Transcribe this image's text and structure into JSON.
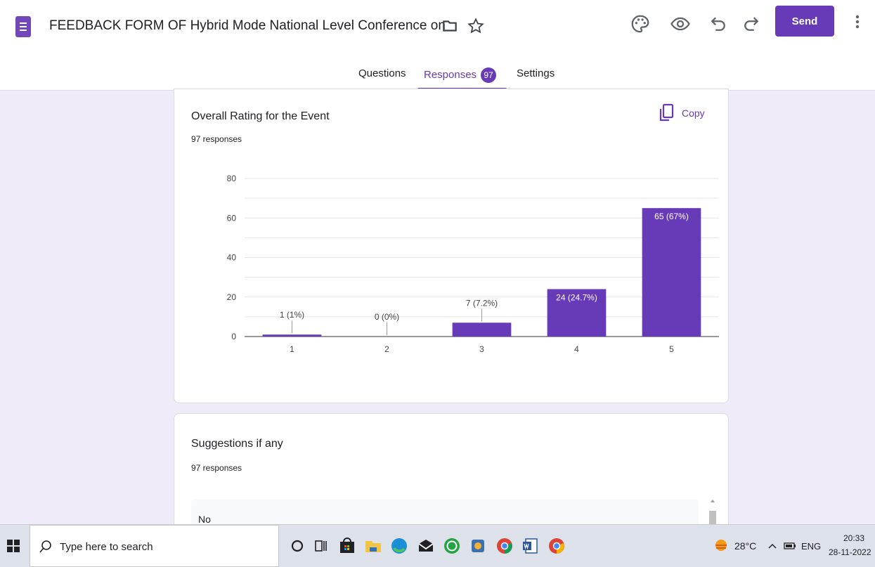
{
  "header": {
    "title": "FEEDBACK FORM OF Hybrid Mode National Level Conference on C",
    "send_label": "Send",
    "icons": [
      "forms-icon",
      "folder-icon",
      "star-icon",
      "palette-icon",
      "preview-icon",
      "undo-icon",
      "redo-icon",
      "more-vert-icon"
    ]
  },
  "tabs": {
    "questions": "Questions",
    "responses": "Responses",
    "responses_count": "97",
    "settings": "Settings",
    "active": "Responses"
  },
  "question1": {
    "title": "Overall Rating for the Event",
    "count": "97 responses",
    "copy_label": "Copy"
  },
  "chart_data": {
    "type": "bar",
    "categories": [
      "1",
      "2",
      "3",
      "4",
      "5"
    ],
    "values": [
      1,
      0,
      7,
      24,
      65
    ],
    "labels": [
      "1 (1%)",
      "0 (0%)",
      "7 (7.2%)",
      "24 (24.7%)",
      "65 (67%)"
    ],
    "yticks": [
      0,
      20,
      40,
      60,
      80
    ],
    "ylim": [
      0,
      80
    ],
    "grid": true,
    "color": "#673ab7"
  },
  "question2": {
    "title": "Suggestions if any",
    "count": "97 responses",
    "answers": [
      "No"
    ]
  },
  "taskbar": {
    "search_placeholder": "Type here to search",
    "temperature": "28°C",
    "language": "ENG",
    "time": "20:33",
    "date": "28-11-2022"
  },
  "colors": {
    "accent": "#673ab7",
    "background": "#f0ebf8"
  }
}
